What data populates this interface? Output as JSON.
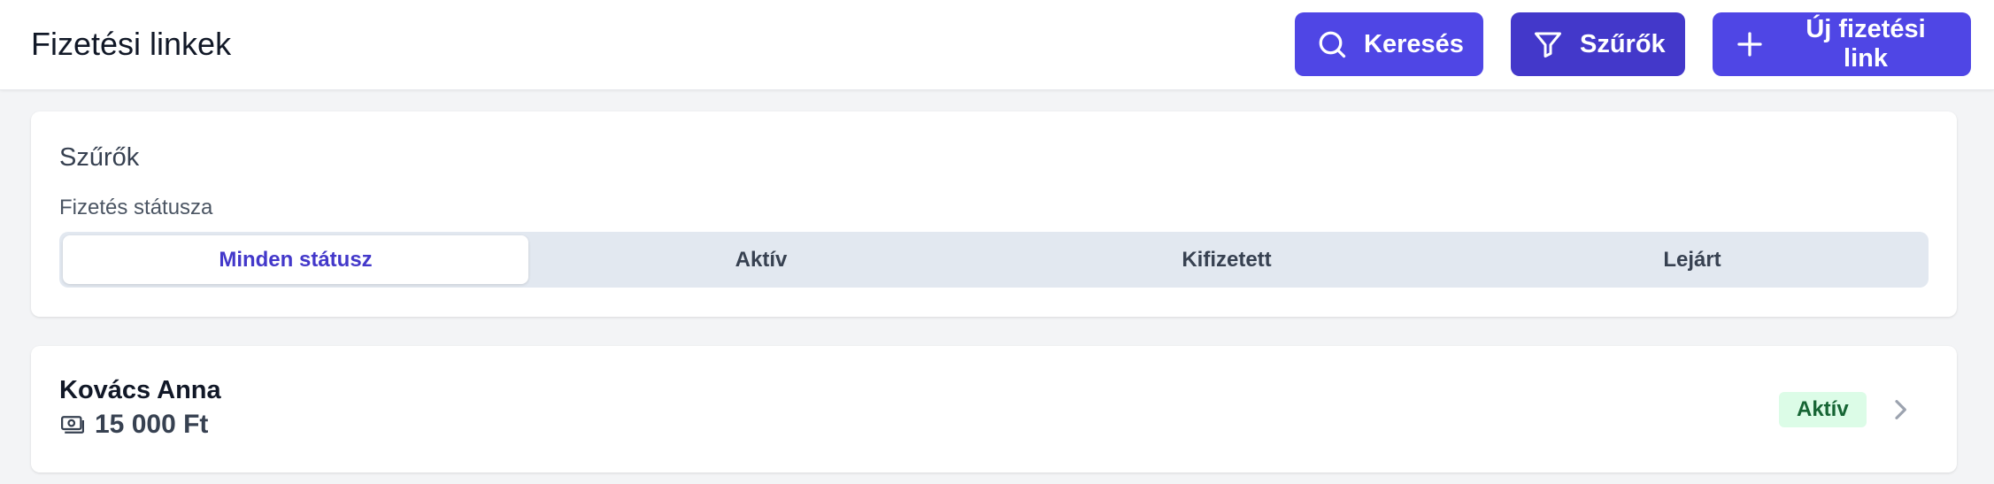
{
  "header": {
    "title": "Fizetési linkek",
    "search_label": "Keresés",
    "filter_label": "Szűrők",
    "new_label": "Új fizetési link"
  },
  "filters": {
    "title": "Szűrők",
    "status_label": "Fizetés státusza",
    "options": [
      "Minden státusz",
      "Aktív",
      "Kifizetett",
      "Lejárt"
    ],
    "selected": "Minden státusz"
  },
  "list": {
    "items": [
      {
        "name": "Kovács Anna",
        "amount": "15 000 Ft",
        "status": "Aktív"
      }
    ]
  },
  "colors": {
    "primary": "#4f46e5",
    "primary_dark": "#4338ca",
    "badge_bg": "#dcfce7",
    "badge_text": "#166534"
  },
  "icons": {
    "search": "search-icon",
    "filter": "filter-funnel-icon",
    "add": "plus-icon",
    "amount": "banknote-icon",
    "row_action": "chevron-right-icon"
  }
}
